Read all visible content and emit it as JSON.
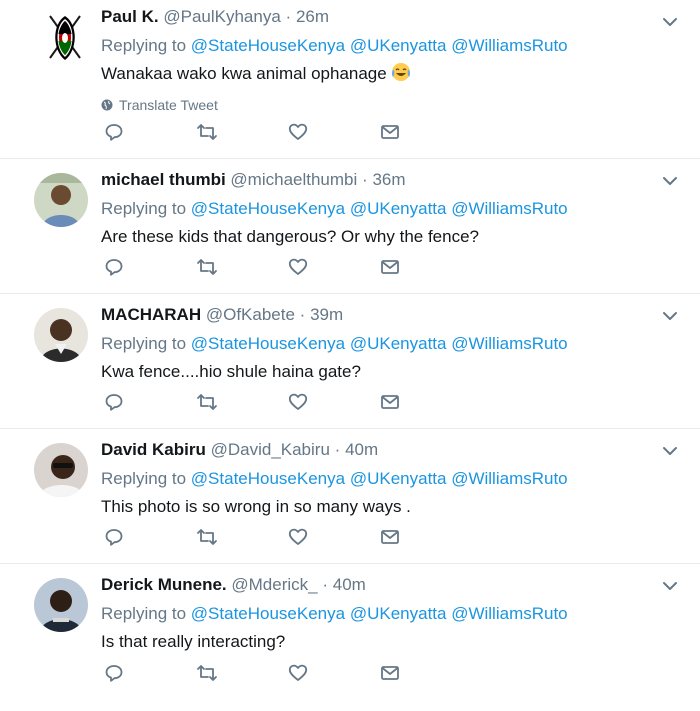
{
  "tweets": [
    {
      "name": "Paul K.",
      "handle": "@PaulKyhanya",
      "time": "26m",
      "replying_prefix": "Replying to",
      "mentions": [
        "@StateHouseKenya",
        "@UKenyatta",
        "@WilliamsRuto"
      ],
      "text": "Wanakaa wako kwa animal ophanage",
      "translate_label": "Translate Tweet",
      "avatar": "kenya-shield-avatar"
    },
    {
      "name": "michael thumbi",
      "handle": "@michaelthumbi",
      "time": "36m",
      "replying_prefix": "Replying to",
      "mentions": [
        "@StateHouseKenya",
        "@UKenyatta",
        "@WilliamsRuto"
      ],
      "text": "Are these kids that dangerous? Or why the fence?",
      "avatar": "user-photo-avatar"
    },
    {
      "name": "MACHARAH",
      "handle": "@OfKabete",
      "time": "39m",
      "replying_prefix": "Replying to",
      "mentions": [
        "@StateHouseKenya",
        "@UKenyatta",
        "@WilliamsRuto"
      ],
      "text": "Kwa fence....hio shule haina gate?",
      "avatar": "user-photo-avatar"
    },
    {
      "name": "David Kabiru",
      "handle": "@David_Kabiru",
      "time": "40m",
      "replying_prefix": "Replying to",
      "mentions": [
        "@StateHouseKenya",
        "@UKenyatta",
        "@WilliamsRuto"
      ],
      "text": "This photo is so wrong in so many ways .",
      "avatar": "user-photo-avatar"
    },
    {
      "name": "Derick Munene.",
      "handle": "@Mderick_",
      "time": "40m",
      "replying_prefix": "Replying to",
      "mentions": [
        "@StateHouseKenya",
        "@UKenyatta",
        "@WilliamsRuto"
      ],
      "text": "Is that really interacting?",
      "avatar": "user-photo-avatar"
    }
  ],
  "colors": {
    "link": "#1b95e0",
    "secondary_text": "#657786",
    "primary_text": "#14171a",
    "divider": "#e6ecf0"
  },
  "icons": [
    "reply-icon",
    "retweet-icon",
    "like-icon",
    "direct-message-icon",
    "caret-down-icon",
    "globe-icon",
    "tears-of-joy-emoji"
  ]
}
